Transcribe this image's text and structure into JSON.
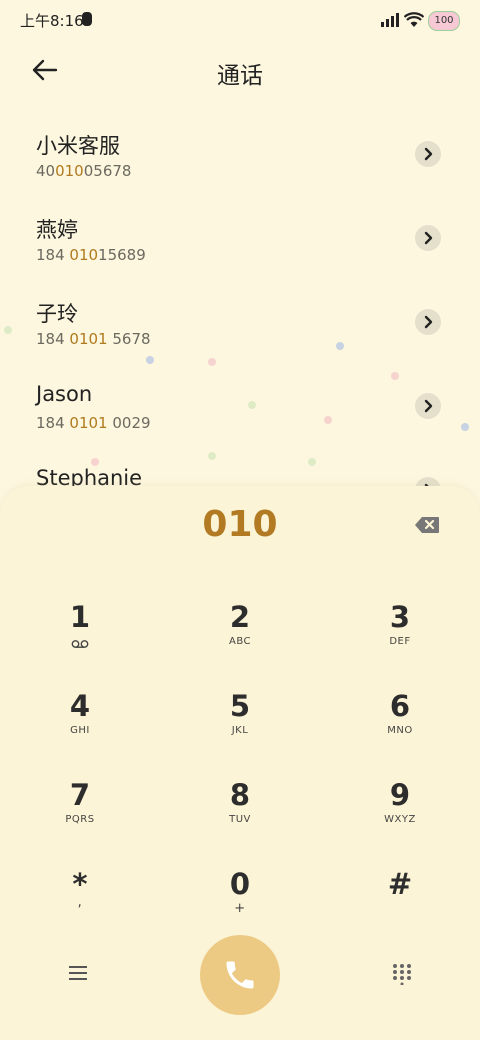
{
  "status_bar": {
    "time": "上午8:16",
    "battery": "100",
    "icons": [
      "signal-icon",
      "wifi-icon",
      "battery-icon"
    ]
  },
  "header": {
    "back_icon": "arrow-left-icon",
    "title": "通话"
  },
  "contacts": [
    {
      "name": "小米客服",
      "number_pre": "40",
      "number_match": "010",
      "number_post": "05678"
    },
    {
      "name": "燕婷",
      "number_pre": "184 ",
      "number_match": "010",
      "number_post": "15689"
    },
    {
      "name": "子玲",
      "number_pre": "184 ",
      "number_match": "0101",
      "number_post": " 5678"
    },
    {
      "name": "Jason",
      "number_pre": "184 ",
      "number_match": "0101",
      "number_post": " 0029"
    },
    {
      "name": "Stephanie",
      "number_pre": "",
      "number_match": "",
      "number_post": ""
    }
  ],
  "dialer": {
    "typed_number": "010",
    "keys": [
      {
        "digit": "1",
        "letters": ""
      },
      {
        "digit": "2",
        "letters": "ABC"
      },
      {
        "digit": "3",
        "letters": "DEF"
      },
      {
        "digit": "4",
        "letters": "GHI"
      },
      {
        "digit": "5",
        "letters": "JKL"
      },
      {
        "digit": "6",
        "letters": "MNO"
      },
      {
        "digit": "7",
        "letters": "PQRS"
      },
      {
        "digit": "8",
        "letters": "TUV"
      },
      {
        "digit": "9",
        "letters": "WXYZ"
      },
      {
        "digit": "*",
        "letters": ","
      },
      {
        "digit": "0",
        "letters": "+"
      },
      {
        "digit": "#",
        "letters": ""
      }
    ]
  },
  "colors": {
    "background": "#fdf7df",
    "highlight": "#b07a1e",
    "call_button": "#ecca84"
  }
}
